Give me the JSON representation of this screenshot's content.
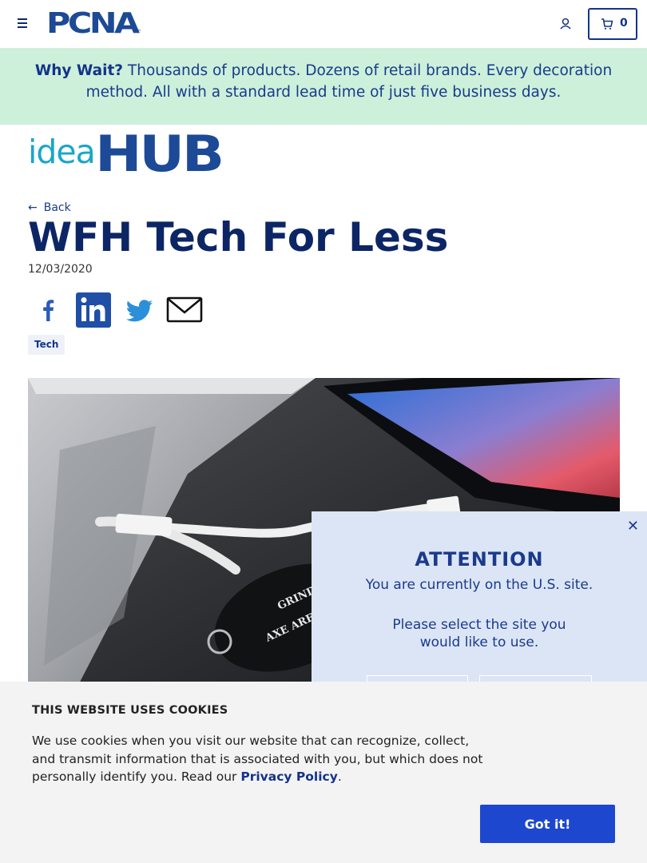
{
  "header": {
    "logo_text": "PCNA",
    "logo_tm": "™",
    "cart_count": "0"
  },
  "promo": {
    "lead": "Why Wait?",
    "text": " Thousands of products. Dozens of retail brands. Every decoration method. All with a standard lead time of just five business days."
  },
  "ideahub": {
    "idea": "idea",
    "hub": "HUB"
  },
  "article": {
    "back_label": "Back",
    "title": "WFH Tech For Less",
    "date": "12/03/2020",
    "tag": "Tech",
    "hero_engraving": [
      "GRINDSTONE",
      "AXE ARENA"
    ]
  },
  "share": [
    "facebook-icon",
    "linkedin-icon",
    "twitter-icon",
    "email-icon"
  ],
  "attention": {
    "title": "ATTENTION",
    "line1": "You are currently on the U.S. site.",
    "line2": "Please select the site you would like to use.",
    "close": "✕"
  },
  "cookies": {
    "title": "THIS WEBSITE USES COOKIES",
    "text": "We use cookies when you visit our website that can recognize, collect, and transmit information that is associated with you, but which does not personally identify you. Read our ",
    "link": "Privacy Policy",
    "after": ".",
    "button": "Got it!"
  },
  "colors": {
    "brand_blue": "#14338a",
    "promo_bg": "#ccf0da",
    "idea_teal": "#1aa6c8",
    "cookie_button": "#1d47cf"
  }
}
